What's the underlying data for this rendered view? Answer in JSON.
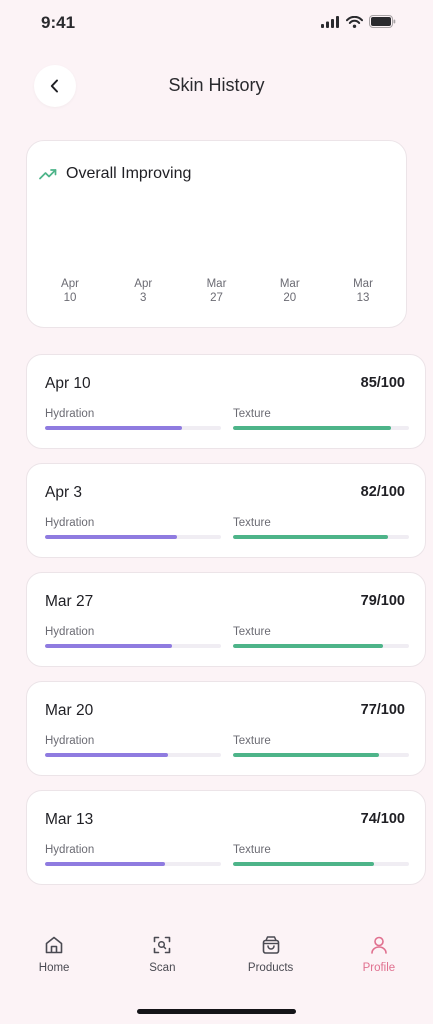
{
  "status_bar": {
    "time": "9:41"
  },
  "header": {
    "title": "Skin History"
  },
  "trend": {
    "title": "Overall Improving",
    "axis": [
      {
        "month": "Apr",
        "day": "10"
      },
      {
        "month": "Apr",
        "day": "3"
      },
      {
        "month": "Mar",
        "day": "27"
      },
      {
        "month": "Mar",
        "day": "20"
      },
      {
        "month": "Mar",
        "day": "13"
      }
    ]
  },
  "metric_labels": {
    "hydration": "Hydration",
    "texture": "Texture"
  },
  "records": [
    {
      "date": "Apr 10",
      "score": "85/100",
      "hydration_level": 0.78,
      "texture_level": 0.9
    },
    {
      "date": "Apr 3",
      "score": "82/100",
      "hydration_level": 0.75,
      "texture_level": 0.88
    },
    {
      "date": "Mar 27",
      "score": "79/100",
      "hydration_level": 0.72,
      "texture_level": 0.85
    },
    {
      "date": "Mar 20",
      "score": "77/100",
      "hydration_level": 0.7,
      "texture_level": 0.83
    },
    {
      "date": "Mar 13",
      "score": "74/100",
      "hydration_level": 0.68,
      "texture_level": 0.8
    }
  ],
  "tabs": [
    {
      "label": "Home",
      "icon": "home-icon",
      "active": false
    },
    {
      "label": "Scan",
      "icon": "scan-icon",
      "active": false
    },
    {
      "label": "Products",
      "icon": "bag-icon",
      "active": false
    },
    {
      "label": "Profile",
      "icon": "profile-icon",
      "active": true
    }
  ],
  "colors": {
    "hydration": "#8f7be0",
    "texture": "#4db489",
    "accent_active": "#e0708f",
    "trend_icon": "#4db489"
  }
}
